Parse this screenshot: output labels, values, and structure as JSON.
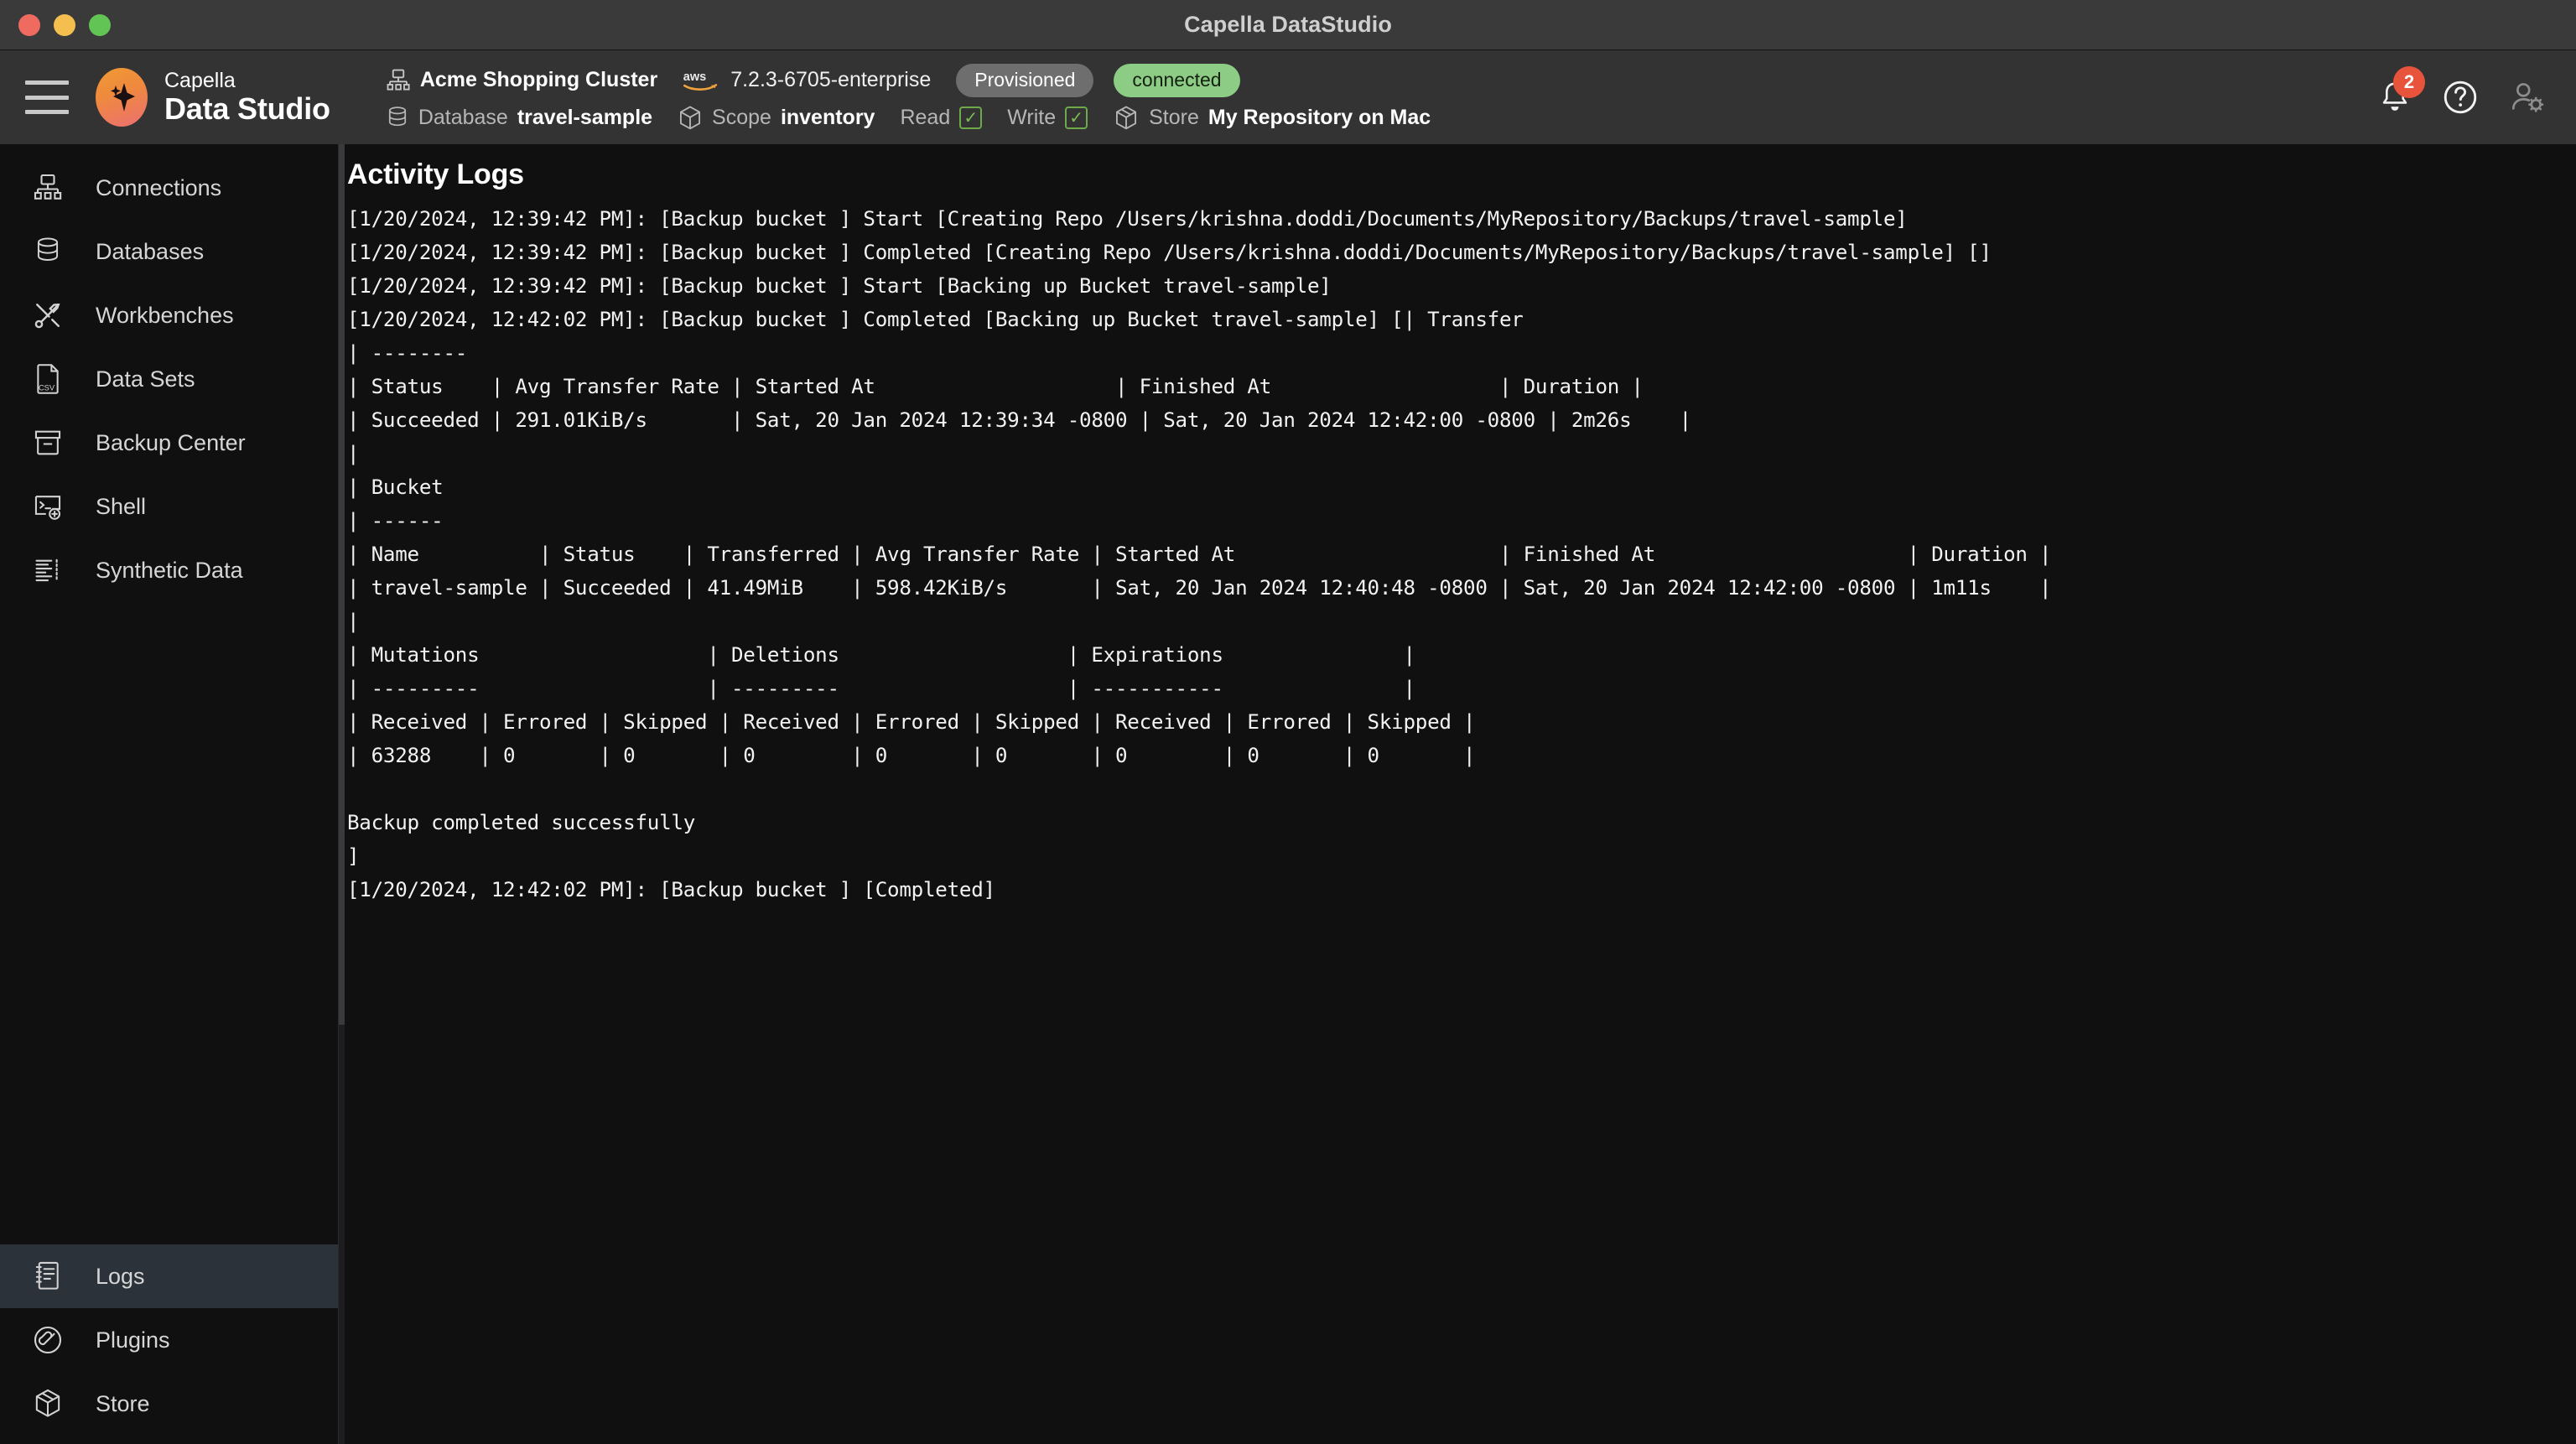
{
  "window": {
    "title": "Capella DataStudio",
    "traffic_lights": [
      "close",
      "minimize",
      "zoom"
    ]
  },
  "header": {
    "menu_icon": "hamburger-icon",
    "brand": {
      "line1": "Capella",
      "line2": "Data Studio",
      "logo_icon": "capella-sparkle-logo"
    },
    "cluster": {
      "icon": "cluster-icon",
      "name": "Acme Shopping Cluster"
    },
    "database": {
      "icon": "database-icon",
      "label": "Database",
      "value": "travel-sample"
    },
    "cloud": {
      "icon": "aws-logo",
      "version": "7.2.3-6705-enterprise"
    },
    "scope": {
      "icon": "cube-icon",
      "label": "Scope",
      "value": "inventory"
    },
    "permissions": {
      "read_label": "Read",
      "read_checked": true,
      "write_label": "Write",
      "write_checked": true,
      "check_glyph": "✓"
    },
    "badges": {
      "provisioned": "Provisioned",
      "connected": "connected"
    },
    "store": {
      "icon": "box-icon",
      "label": "Store",
      "value": "My Repository on Mac"
    },
    "actions": {
      "notifications_icon": "bell-icon",
      "notifications_count": "2",
      "help_icon": "question-circle-icon",
      "account_icon": "user-settings-icon"
    }
  },
  "sidebar": {
    "primary_items": [
      {
        "label": "Connections",
        "icon": "cluster-icon",
        "active": false
      },
      {
        "label": "Databases",
        "icon": "database-icon",
        "active": false
      },
      {
        "label": "Workbenches",
        "icon": "tools-icon",
        "active": false
      },
      {
        "label": "Data Sets",
        "icon": "csv-file-icon",
        "active": false
      },
      {
        "label": "Backup Center",
        "icon": "archive-icon",
        "active": false
      },
      {
        "label": "Shell",
        "icon": "terminal-icon",
        "active": false
      },
      {
        "label": "Synthetic Data",
        "icon": "bars-list-icon",
        "active": false
      }
    ],
    "secondary_items": [
      {
        "label": "Logs",
        "icon": "logs-icon",
        "active": true
      },
      {
        "label": "Plugins",
        "icon": "plug-icon",
        "active": false
      },
      {
        "label": "Store",
        "icon": "box-icon",
        "active": false
      }
    ]
  },
  "main": {
    "title": "Activity Logs",
    "log_text": "[1/20/2024, 12:39:42 PM]: [Backup bucket ] Start [Creating Repo /Users/krishna.doddi/Documents/MyRepository/Backups/travel-sample]\n[1/20/2024, 12:39:42 PM]: [Backup bucket ] Completed [Creating Repo /Users/krishna.doddi/Documents/MyRepository/Backups/travel-sample] []\n[1/20/2024, 12:39:42 PM]: [Backup bucket ] Start [Backing up Bucket travel-sample]\n[1/20/2024, 12:42:02 PM]: [Backup bucket ] Completed [Backing up Bucket travel-sample] [| Transfer\n| --------\n| Status    | Avg Transfer Rate | Started At                    | Finished At                   | Duration |\n| Succeeded | 291.01KiB/s       | Sat, 20 Jan 2024 12:39:34 -0800 | Sat, 20 Jan 2024 12:42:00 -0800 | 2m26s    |\n|\n| Bucket\n| ------\n| Name          | Status    | Transferred | Avg Transfer Rate | Started At                      | Finished At                     | Duration |\n| travel-sample | Succeeded | 41.49MiB    | 598.42KiB/s       | Sat, 20 Jan 2024 12:40:48 -0800 | Sat, 20 Jan 2024 12:42:00 -0800 | 1m11s    |\n|\n| Mutations                   | Deletions                   | Expirations               |\n| ---------                   | ---------                   | -----------               |\n| Received | Errored | Skipped | Received | Errored | Skipped | Received | Errored | Skipped |\n| 63288    | 0       | 0       | 0        | 0       | 0       | 0        | 0       | 0       |\n\nBackup completed successfully\n]\n[1/20/2024, 12:42:02 PM]: [Backup bucket ] [Completed]",
    "log_summary": {
      "transfer": {
        "section": "Transfer",
        "columns": [
          "Status",
          "Avg Transfer Rate",
          "Started At",
          "Finished At",
          "Duration"
        ],
        "rows": [
          [
            "Succeeded",
            "291.01KiB/s",
            "Sat, 20 Jan 2024 12:39:34 -0800",
            "Sat, 20 Jan 2024 12:42:00 -0800",
            "2m26s"
          ]
        ]
      },
      "bucket": {
        "section": "Bucket",
        "columns": [
          "Name",
          "Status",
          "Transferred",
          "Avg Transfer Rate",
          "Started At",
          "Finished At",
          "Duration"
        ],
        "rows": [
          [
            "travel-sample",
            "Succeeded",
            "41.49MiB",
            "598.42KiB/s",
            "Sat, 20 Jan 2024 12:40:48 -0800",
            "Sat, 20 Jan 2024 12:42:00 -0800",
            "1m11s"
          ]
        ]
      },
      "counters": {
        "groups": [
          "Mutations",
          "Deletions",
          "Expirations"
        ],
        "columns": [
          "Received",
          "Errored",
          "Skipped"
        ],
        "values": [
          [
            "63288",
            "0",
            "0"
          ],
          [
            "0",
            "0",
            "0"
          ],
          [
            "0",
            "0",
            "0"
          ]
        ]
      },
      "final_message": "Backup completed successfully"
    }
  },
  "colors": {
    "accent_orange": "#ef8a3c",
    "accent_pink": "#ec6f72",
    "status_connected": "#8ccc85",
    "status_provisioned": "#6e6e6e",
    "badge_red": "#e8533c",
    "check_green": "#6faa4a",
    "sidebar_active": "#2b3239"
  }
}
